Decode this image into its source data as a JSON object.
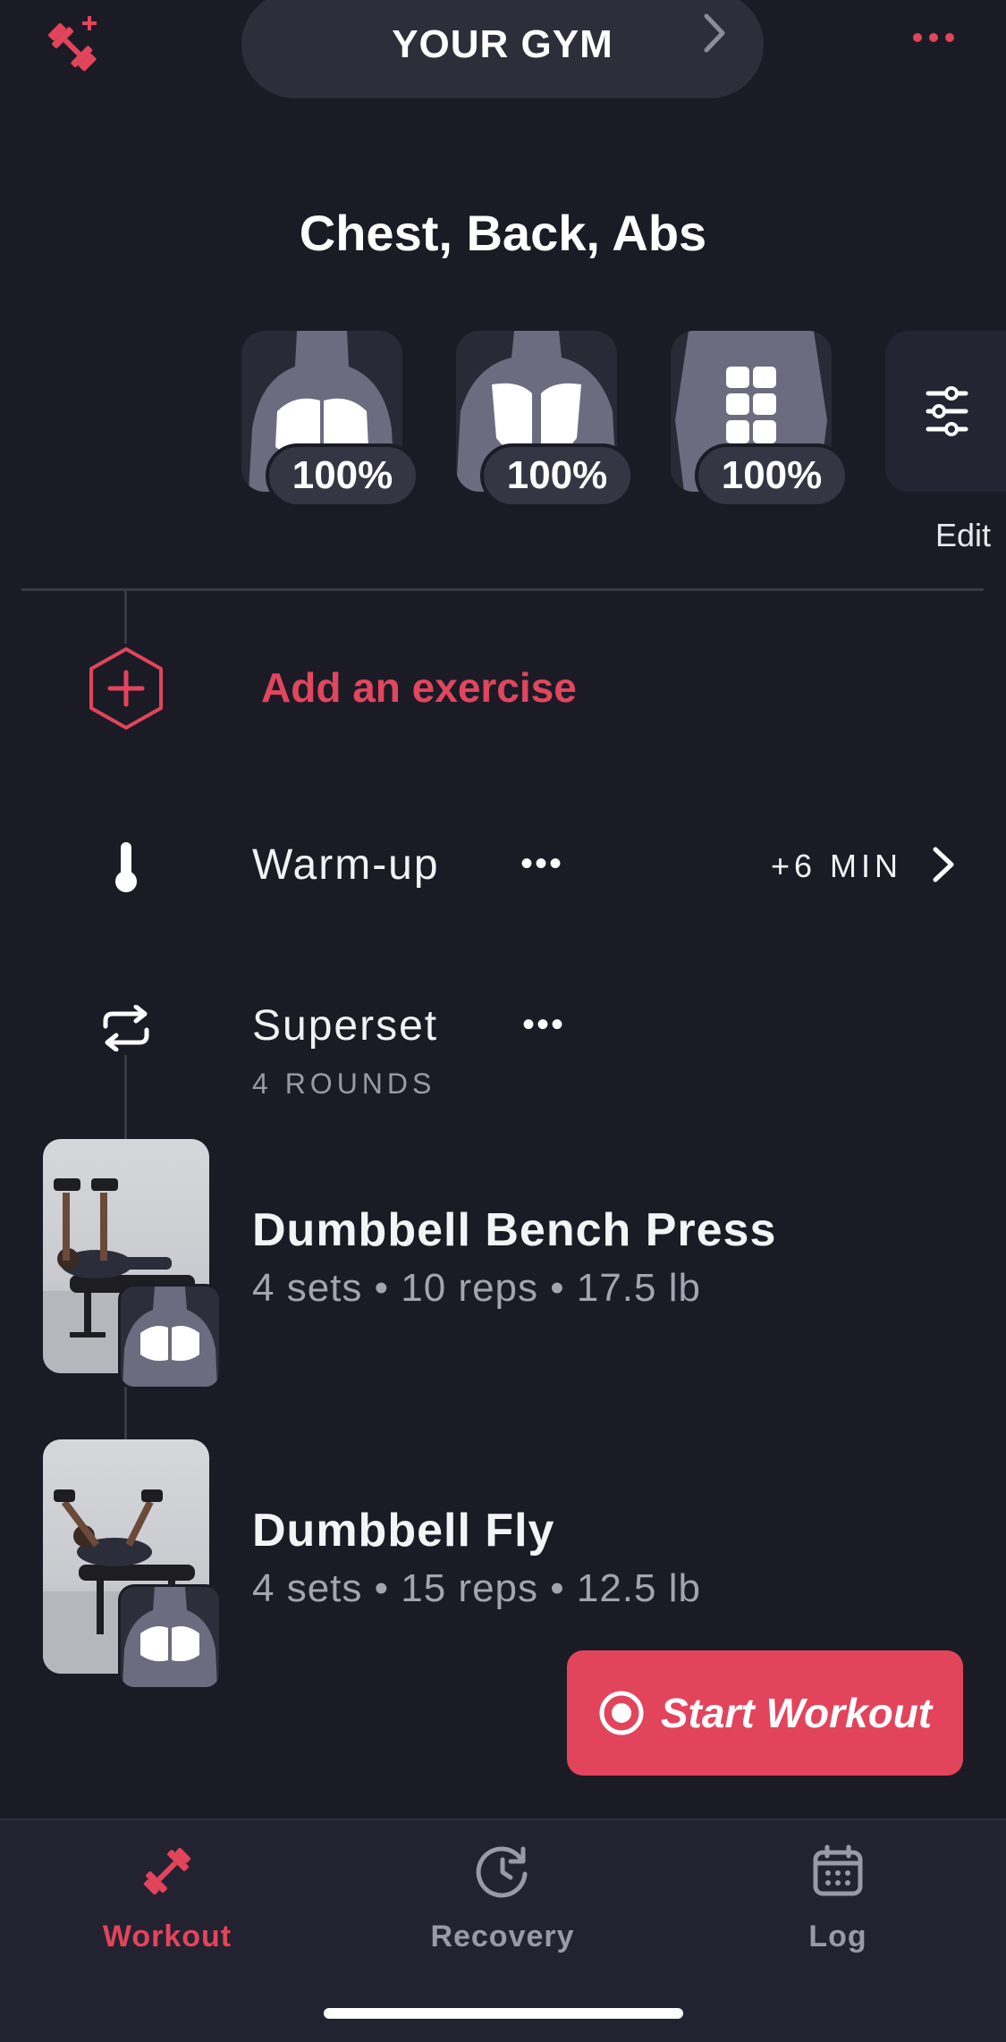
{
  "header": {
    "gym_label": "YOUR GYM"
  },
  "workout_title": "Chest, Back, Abs",
  "muscles": [
    {
      "name": "Chest",
      "percent": "100%"
    },
    {
      "name": "Back",
      "percent": "100%"
    },
    {
      "name": "Abs",
      "percent": "100%"
    }
  ],
  "edit_label": "Edit",
  "add_exercise_label": "Add an exercise",
  "warmup": {
    "label": "Warm-up",
    "more": "•••",
    "duration": "+6 MIN"
  },
  "superset": {
    "label": "Superset",
    "more": "•••",
    "rounds": "4 ROUNDS"
  },
  "exercises": [
    {
      "name": "Dumbbell Bench Press",
      "detail": "4 sets • 10 reps • 17.5 lb"
    },
    {
      "name": "Dumbbell Fly",
      "detail": "4 sets • 15 reps • 12.5 lb"
    }
  ],
  "start_button_label": "Start Workout",
  "tabs": [
    {
      "label": "Workout",
      "icon": "dumbbell-icon",
      "active": true
    },
    {
      "label": "Recovery",
      "icon": "recovery-clock-icon",
      "active": false
    },
    {
      "label": "Log",
      "icon": "calendar-icon",
      "active": false
    }
  ],
  "colors": {
    "background": "#1b1b26",
    "accent": "#e2445c",
    "muted_text": "#a4a3b0",
    "pill": "#2e2d3a"
  }
}
